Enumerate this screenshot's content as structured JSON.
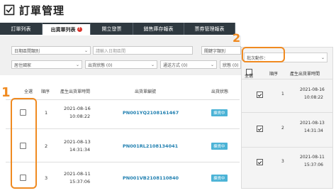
{
  "page": {
    "title": "訂單管理"
  },
  "tabs": [
    {
      "label": "訂單列表",
      "active": false,
      "badge": ""
    },
    {
      "label": "出貨單列表",
      "active": true,
      "badge": "?"
    },
    {
      "label": "開立發票",
      "active": false,
      "badge": ""
    },
    {
      "label": "銷售庫存報表",
      "active": false,
      "badge": ""
    },
    {
      "label": "票券管理報表",
      "active": false,
      "badge": ""
    }
  ],
  "filters": {
    "date_range_label": "日期區間類別",
    "date_input_placeholder": "請輸入日期區間",
    "keyword_label": "關鍵字類別",
    "country_label": "居住國家",
    "shipping_status": "出貨狀態 (0)",
    "shipping_method": "通送方式 (0)",
    "extra_status": "狀態 (0)"
  },
  "table": {
    "headers": {
      "select_all": "全選",
      "seq": "順序",
      "time": "產生出貨單時間",
      "order_no": "出貨單編號",
      "status": "出貨狀態"
    },
    "rows": [
      {
        "seq": "1",
        "date": "2021-08-16",
        "time": "10:08:22",
        "order_no": "PN001YQ2108161467",
        "status": "揀貨中"
      },
      {
        "seq": "2",
        "date": "2021-08-13",
        "time": "14:31:34",
        "order_no": "PN001RL2108134041",
        "status": "揀貨中"
      },
      {
        "seq": "3",
        "date": "2021-08-11",
        "time": "15:37:06",
        "order_no": "PN001VB2108110840",
        "status": "揀貨中"
      }
    ]
  },
  "panel": {
    "batch_action": "批次動作：",
    "headers": {
      "select_all": "全選",
      "seq": "順序",
      "time": "產生出貨單時間"
    },
    "rows": [
      {
        "seq": "1",
        "date": "2021-08-16",
        "time": "10:08:22"
      },
      {
        "seq": "2",
        "date": "2021-08-13",
        "time": "14:31:34"
      },
      {
        "seq": "3",
        "date": "2021-08-11",
        "time": "15:37:06"
      }
    ]
  },
  "callouts": {
    "one": "1",
    "two": "2"
  },
  "colors": {
    "tabbar": "#2f3940",
    "accent_orange": "#f08a20",
    "order_link": "#1f7fb0",
    "status_badge": "#4bb3d6"
  }
}
